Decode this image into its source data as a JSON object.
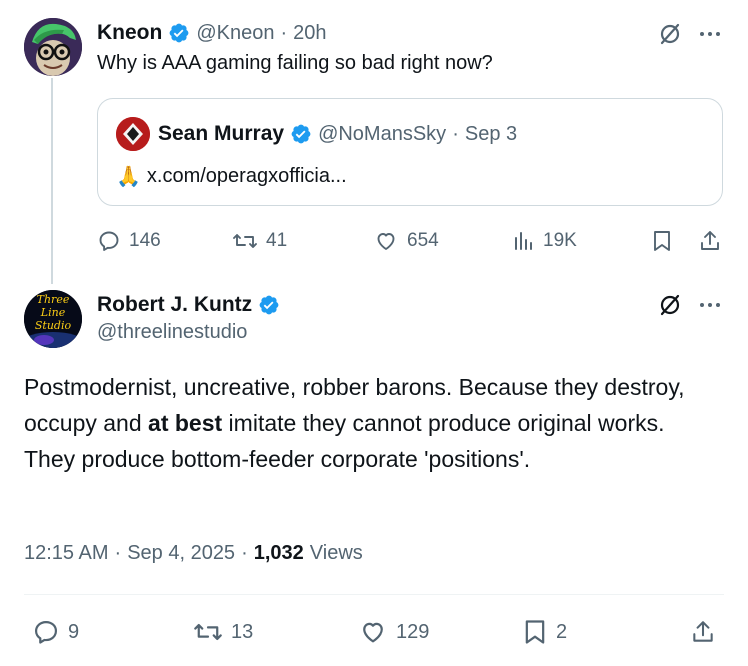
{
  "tweet1": {
    "name": "Kneon",
    "handle": "@Kneon",
    "sep": "·",
    "time": "20h",
    "text": "Why is AAA gaming failing so bad right now?",
    "stats": {
      "replies": "146",
      "reposts": "41",
      "likes": "654",
      "views": "19K"
    }
  },
  "quote": {
    "name": "Sean Murray",
    "handle": "@NoMansSky",
    "sep": "·",
    "date": "Sep 3",
    "emoji": "🙏",
    "link": "x.com/operagxofficia..."
  },
  "tweet2": {
    "name": "Robert J. Kuntz",
    "handle": "@threelinestudio",
    "avatar_text": [
      "Three",
      "Line",
      "Studio"
    ],
    "text_part1": "Postmodernist, uncreative, robber barons.  Because they destroy, occupy and ",
    "text_bold": "at best",
    "text_part2": " imitate they cannot produce original works.  They produce bottom-feeder corporate 'positions'.",
    "time": "12:15 AM",
    "date": "Sep 4, 2025",
    "sep": "·",
    "views_count": "1,032",
    "views_label": "Views",
    "stats": {
      "replies": "9",
      "reposts": "13",
      "likes": "129",
      "bookmarks": "2"
    }
  },
  "colors": {
    "verified": "#1d9bf0",
    "muted": "#536471",
    "text": "#0f1419",
    "border": "#cfd9de"
  }
}
